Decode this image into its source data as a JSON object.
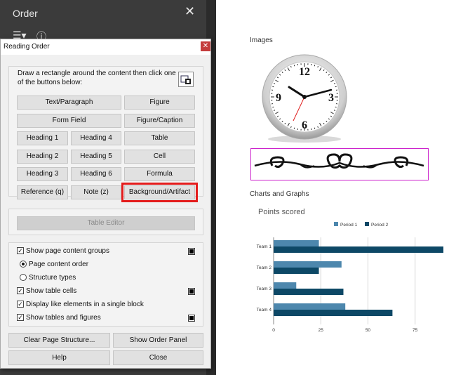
{
  "order_panel": {
    "title": "Order",
    "close_glyph": "✕",
    "toolbar_icons": [
      "options-list-icon",
      "info-icon"
    ]
  },
  "document": {
    "images_label": "Images",
    "charts_label": "Charts and Graphs"
  },
  "dialog": {
    "title": "Reading Order",
    "close_glyph": "✕",
    "instructions": "Draw a rectangle around the content then click one of the buttons below:",
    "buttons": {
      "text_paragraph": "Text/Paragraph",
      "figure": "Figure",
      "form_field": "Form Field",
      "figure_caption": "Figure/Caption",
      "heading1": "Heading 1",
      "heading4": "Heading 4",
      "table": "Table",
      "heading2": "Heading 2",
      "heading5": "Heading 5",
      "cell": "Cell",
      "heading3": "Heading 3",
      "heading6": "Heading 6",
      "formula": "Formula",
      "reference": "Reference (q)",
      "note": "Note (z)",
      "background_artifact": "Background/Artifact",
      "table_editor": "Table Editor",
      "clear_structure": "Clear Page Structure...",
      "show_order_panel": "Show Order Panel",
      "help": "Help",
      "close": "Close"
    },
    "options": {
      "show_content_groups": {
        "label": "Show page content groups",
        "checked": true
      },
      "page_content_order": {
        "label": "Page content order",
        "selected": true
      },
      "structure_types": {
        "label": "Structure types",
        "selected": false
      },
      "show_table_cells": {
        "label": "Show table cells",
        "checked": true
      },
      "display_like_elements": {
        "label": "Display like elements in a single block",
        "checked": true
      },
      "show_tables_figures": {
        "label": "Show tables and figures",
        "checked": true
      }
    },
    "highlight_color": "#e41c1c"
  },
  "clock": {
    "numerals": [
      "12",
      "3",
      "6",
      "9"
    ]
  },
  "chart_data": {
    "type": "bar",
    "orientation": "horizontal",
    "title": "Points scored",
    "categories": [
      "Team 1",
      "Team 2",
      "Team 3",
      "Team 4"
    ],
    "series": [
      {
        "name": "Period 1",
        "color": "#4d87ad",
        "values": [
          24,
          36,
          12,
          38
        ]
      },
      {
        "name": "Period 2",
        "color": "#0d4866",
        "values": [
          90,
          24,
          37,
          63
        ]
      }
    ],
    "xticks": [
      "0",
      "25",
      "50",
      "75"
    ],
    "xlim": [
      0,
      90
    ],
    "grid": true,
    "legend": "top"
  }
}
